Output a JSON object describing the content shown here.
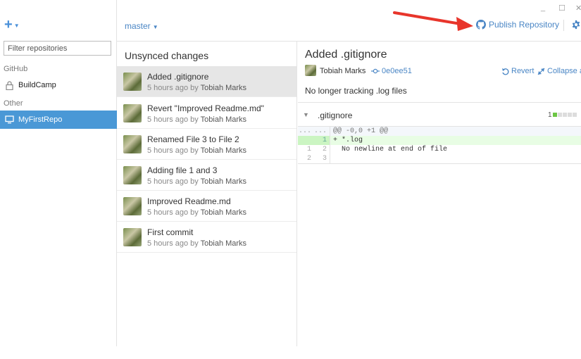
{
  "window": {
    "minimize": "_",
    "maximize": "☐",
    "close": "✕"
  },
  "sidebar": {
    "add_icon": "plus-icon",
    "filter_placeholder": "Filter repositories",
    "groups": [
      {
        "label": "GitHub",
        "repos": [
          {
            "name": "BuildCamp",
            "icon": "lock-icon"
          }
        ]
      },
      {
        "label": "Other",
        "repos": [
          {
            "name": "MyFirstRepo",
            "icon": "monitor-icon",
            "active": true
          }
        ]
      }
    ]
  },
  "toolbar": {
    "branch": "master",
    "publish_label": "Publish Repository",
    "accent": "#4a86c5",
    "arrow_color": "#e8352b"
  },
  "commits": {
    "heading": "Unsynced changes",
    "items": [
      {
        "title": "Added .gitignore",
        "time": "5 hours ago by",
        "author": "Tobiah Marks"
      },
      {
        "title": "Revert \"Improved Readme.md\"",
        "time": "5 hours ago by",
        "author": "Tobiah Marks"
      },
      {
        "title": "Renamed File 3 to File 2",
        "time": "5 hours ago by",
        "author": "Tobiah Marks"
      },
      {
        "title": "Adding file 1 and 3",
        "time": "5 hours ago by",
        "author": "Tobiah Marks"
      },
      {
        "title": "Improved Readme.md",
        "time": "5 hours ago by",
        "author": "Tobiah Marks"
      },
      {
        "title": "First commit",
        "time": "5 hours ago by",
        "author": "Tobiah Marks"
      }
    ]
  },
  "detail": {
    "title": "Added .gitignore",
    "author": "Tobiah Marks",
    "sha": "0e0ee51",
    "revert_label": "Revert",
    "collapse_label": "Collapse al",
    "message": "No longer tracking .log files",
    "file": {
      "name": ".gitignore",
      "additions": "1",
      "diff": [
        {
          "n1": "...",
          "n2": "...",
          "code": "@@ -0,0 +1 @@",
          "kind": "hunk"
        },
        {
          "n1": "",
          "n2": "1",
          "code": "+ *.log",
          "kind": "add"
        },
        {
          "n1": "1",
          "n2": "2",
          "code": "  No newline at end of file",
          "kind": "ctx"
        },
        {
          "n1": "2",
          "n2": "3",
          "code": "",
          "kind": "ctx"
        }
      ]
    }
  }
}
